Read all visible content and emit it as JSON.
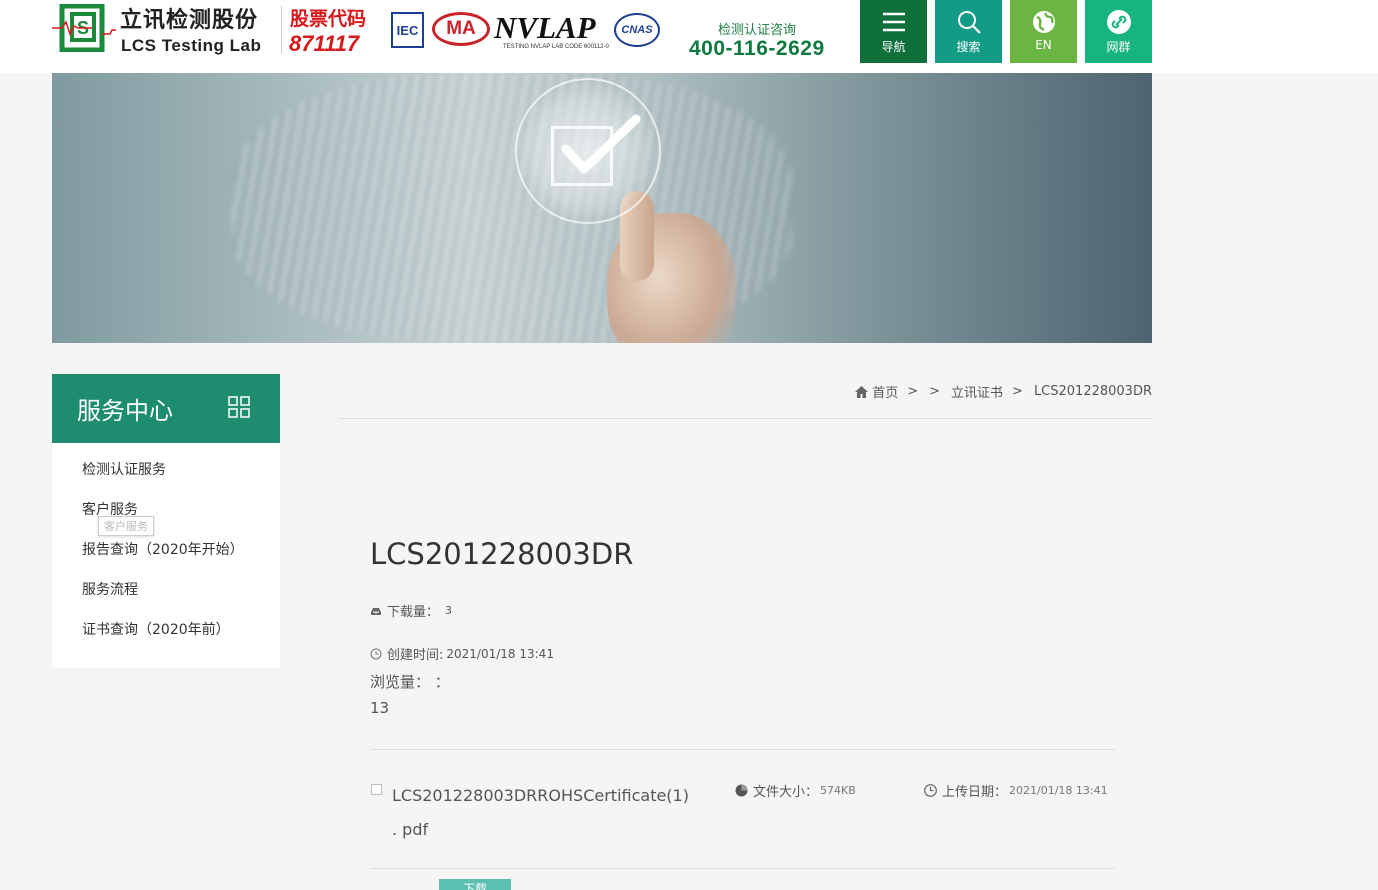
{
  "header": {
    "logo_cn": "立讯检测股份",
    "logo_en": "LCS Testing Lab",
    "stock_label": "股票代码",
    "stock_code": "871117",
    "certs": {
      "iec": "IEC",
      "ma": "MA",
      "nvlap": "NVLAP",
      "nvlap_sub": "TESTING NVLAP LAB CODE 600112-0",
      "cnas": "CNAS"
    },
    "hotline_label": "检测认证咨询",
    "hotline_number": "400-116-2629",
    "nav_buttons": [
      {
        "label": "导航",
        "icon": "menu-icon",
        "color": "#0e6f3a"
      },
      {
        "label": "搜索",
        "icon": "search-icon",
        "color": "#139c85"
      },
      {
        "label": "EN",
        "icon": "globe-icon",
        "color": "#6bb642"
      },
      {
        "label": "网群",
        "icon": "link-icon",
        "color": "#17b47e"
      }
    ]
  },
  "sidebar": {
    "title": "服务中心",
    "items": [
      {
        "label": "检测认证服务"
      },
      {
        "label": "客户服务"
      },
      {
        "label": "报告查询（2020年开始）"
      },
      {
        "label": "服务流程"
      },
      {
        "label": "证书查询（2020年前）"
      }
    ],
    "tooltip": "客户服务"
  },
  "breadcrumb": {
    "home": "首页",
    "sep": ">",
    "section": "立讯证书",
    "current": "LCS201228003DR"
  },
  "document": {
    "title": "LCS201228003DR",
    "downloads_label": "下载量：",
    "downloads_value": "3",
    "created_label": "创建时间:",
    "created_value": "2021/01/18 13:41",
    "views_label": "浏览量：  ：",
    "views_value": "13"
  },
  "file": {
    "name": "LCS201228003DRROHSCertificate(1) . pdf",
    "size_label": "文件大小：",
    "size_value": "574KB",
    "date_label": "上传日期：",
    "date_value": "2021/01/18 13:41"
  },
  "download_button": "下载",
  "colors": {
    "brand_green": "#1e8c6f",
    "nav_dark": "#0e6f3a",
    "stock_red": "#d7191c",
    "button_teal": "#5cc0b0"
  }
}
